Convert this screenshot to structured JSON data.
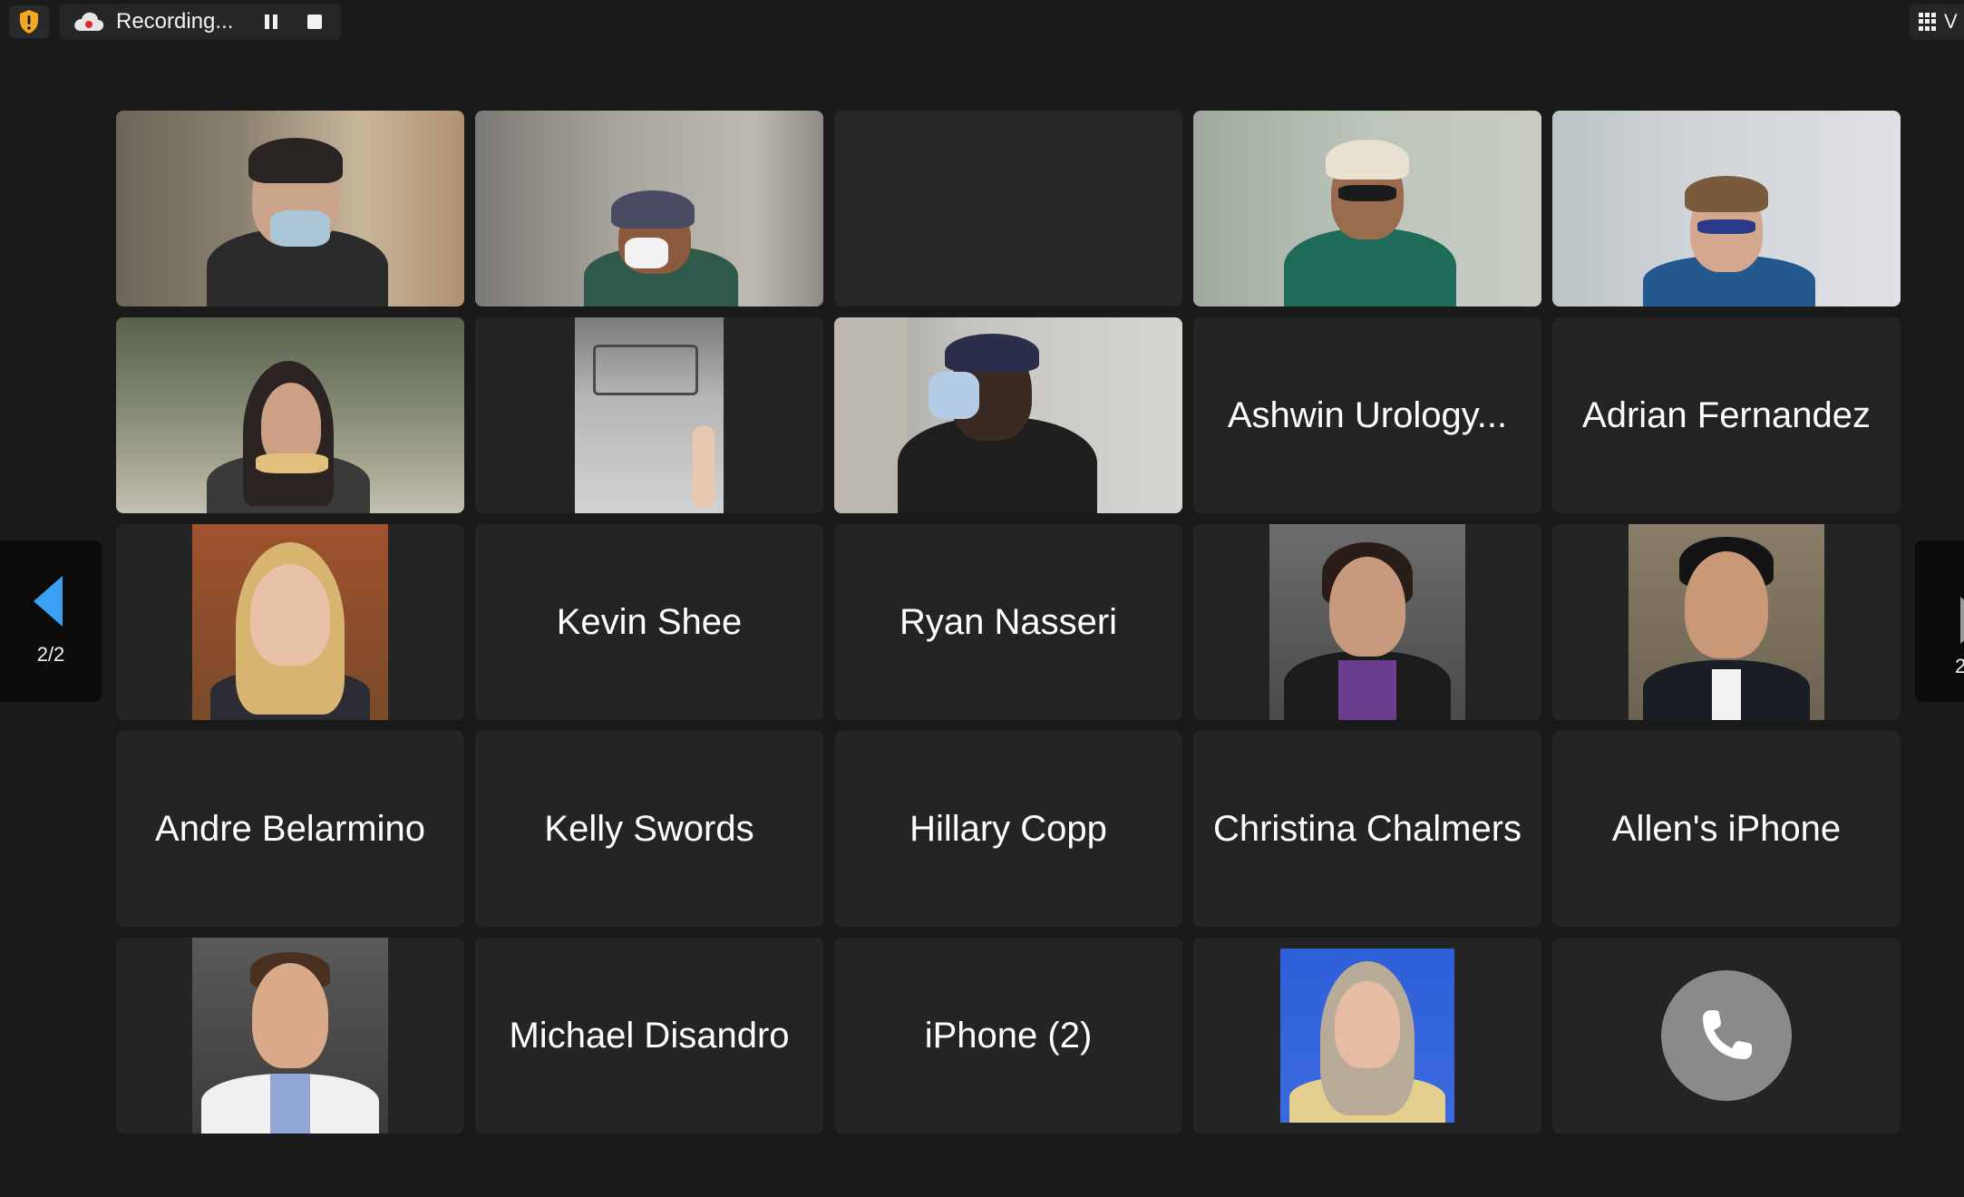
{
  "recording": {
    "label": "Recording..."
  },
  "view_button": {
    "label": "V"
  },
  "pagination": {
    "left": "2/2",
    "right": "2"
  },
  "tiles": [
    {
      "type": "video",
      "name": ""
    },
    {
      "type": "video",
      "name": ""
    },
    {
      "type": "empty",
      "name": ""
    },
    {
      "type": "video",
      "name": ""
    },
    {
      "type": "video",
      "name": ""
    },
    {
      "type": "video",
      "name": ""
    },
    {
      "type": "video",
      "name": ""
    },
    {
      "type": "video",
      "name": ""
    },
    {
      "type": "name",
      "name": "Ashwin Urology..."
    },
    {
      "type": "name",
      "name": "Adrian Fernandez"
    },
    {
      "type": "photo",
      "name": ""
    },
    {
      "type": "name",
      "name": "Kevin Shee"
    },
    {
      "type": "name",
      "name": "Ryan Nasseri"
    },
    {
      "type": "photo",
      "name": ""
    },
    {
      "type": "photo",
      "name": ""
    },
    {
      "type": "name",
      "name": "Andre Belarmino"
    },
    {
      "type": "name",
      "name": "Kelly Swords"
    },
    {
      "type": "name",
      "name": "Hillary Copp"
    },
    {
      "type": "name",
      "name": "Christina Chalmers"
    },
    {
      "type": "name",
      "name": "Allen's iPhone"
    },
    {
      "type": "photo",
      "name": ""
    },
    {
      "type": "name",
      "name": "Michael Disandro"
    },
    {
      "type": "name",
      "name": "iPhone (2)"
    },
    {
      "type": "photo",
      "name": ""
    },
    {
      "type": "phone",
      "name": ""
    }
  ],
  "colors": {
    "background": "#1a1a1a",
    "tile": "#242424",
    "accent_arrow": "#3aa0f3",
    "shield": "#f5a623",
    "recording_dot": "#e02828"
  }
}
